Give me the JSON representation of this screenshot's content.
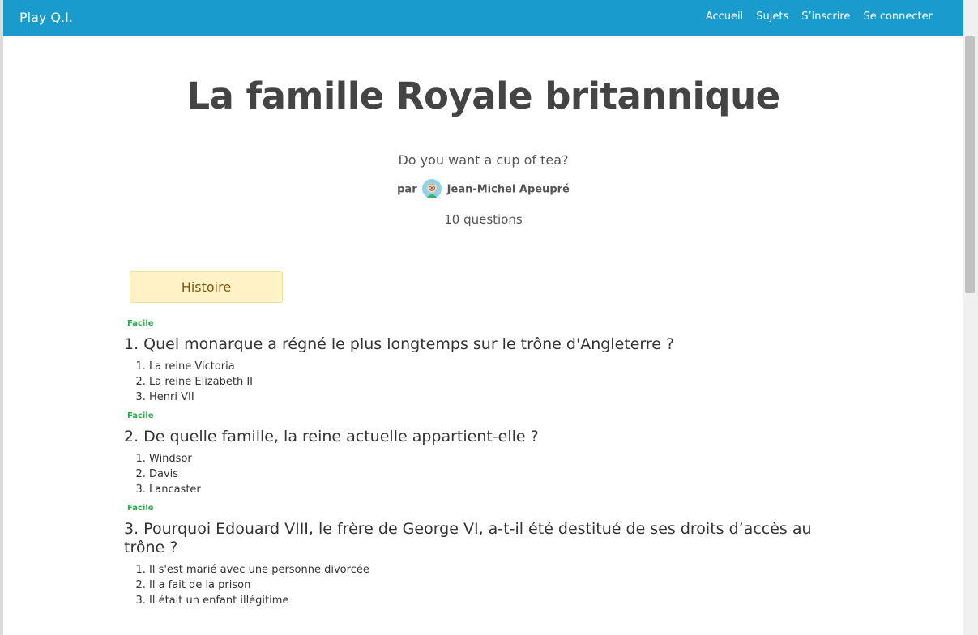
{
  "navbar": {
    "brand": "Play Q.I.",
    "links": [
      "Accueil",
      "Sujets",
      "S’inscrire",
      "Se connecter"
    ],
    "bg_color": "#1a9bce"
  },
  "quiz": {
    "title": "La famille Royale britannique",
    "subtitle": "Do you want a cup of tea?",
    "author_prefix": "par",
    "author_name": "Jean-Michel Apeupré",
    "question_count": "10 questions",
    "category": "Histoire"
  },
  "questions": [
    {
      "difficulty": "Facile",
      "title": "1. Quel monarque a régné le plus longtemps sur le trône d'Angleterre ?",
      "answers": [
        "La reine Victoria",
        "La reine Elizabeth II",
        "Henri VII"
      ]
    },
    {
      "difficulty": "Facile",
      "title": "2. De quelle famille, la reine actuelle appartient-elle ?",
      "answers": [
        "Windsor",
        "Davis",
        "Lancaster"
      ]
    },
    {
      "difficulty": "Facile",
      "title": "3. Pourquoi Edouard VIII, le frère de George VI, a-t-il été destitué de ses droits d’accès au trône ?",
      "answers": [
        "Il s'est marié avec une personne divorcée",
        "Il a fait de la prison",
        "Il était un enfant illégitime"
      ]
    }
  ]
}
